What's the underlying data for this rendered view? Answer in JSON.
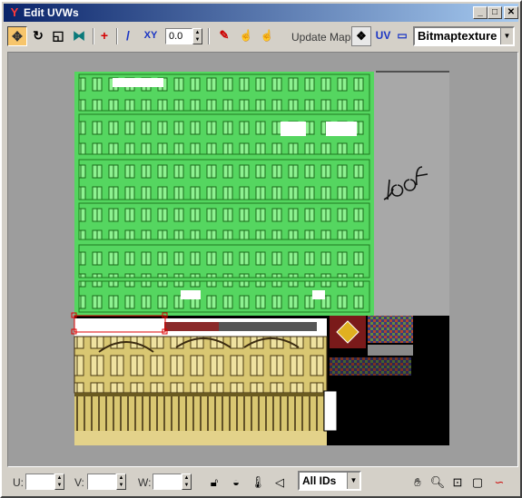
{
  "window": {
    "title": "Edit UVWs",
    "controls": {
      "minimize": "_",
      "maximize": "□",
      "close": "✕"
    }
  },
  "toolbar": {
    "tools": [
      {
        "name": "move-tool",
        "glyph": "✥",
        "pressed": true
      },
      {
        "name": "rotate-tool",
        "glyph": "↻"
      },
      {
        "name": "scale-tool",
        "glyph": "◱"
      },
      {
        "name": "mirror-tool",
        "glyph": "⧓"
      },
      {
        "name": "pan-cross-tool",
        "glyph": "+"
      },
      {
        "name": "freeform-tool",
        "glyph": "/"
      }
    ],
    "xy_label": "XY",
    "spinner_value": "0.0",
    "update_map_label": "Update Map",
    "uv_label": "UV",
    "map_dropdown_value": "Bitmaptexture"
  },
  "canvas": {
    "annotation_text": "roof"
  },
  "status": {
    "u_label": "U:",
    "v_label": "V:",
    "w_label": "W:",
    "u_value": "",
    "v_value": "",
    "w_value": "",
    "ids_dropdown_value": "All IDs"
  },
  "colors": {
    "title_start": "#0a246a",
    "title_end": "#a6caf0",
    "facade_green": "#4fd35a",
    "texture_yellow": "#d8c46a",
    "viewport_gray": "#9d9d9d"
  }
}
